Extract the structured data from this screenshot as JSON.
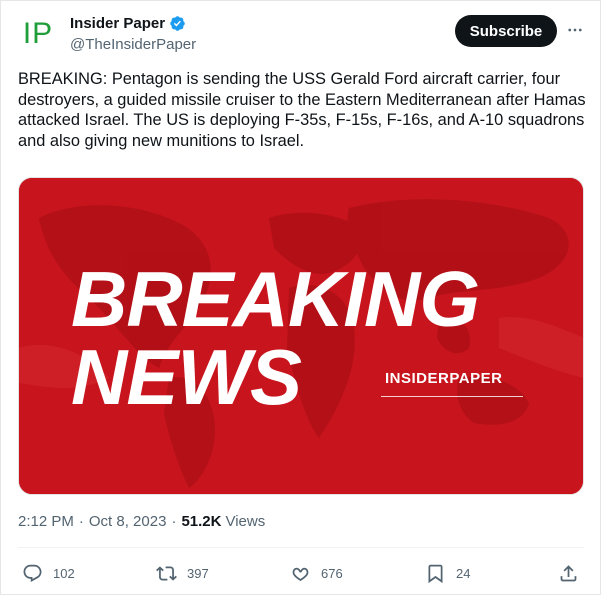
{
  "author": {
    "display_name": "Insider Paper",
    "handle": "@TheInsiderPaper",
    "avatar_text": "IP",
    "verified": true
  },
  "subscribe_label": "Subscribe",
  "tweet": {
    "text": "BREAKING: Pentagon is sending the USS Gerald Ford aircraft carrier, four destroyers, a guided missile cruiser to the Eastern Mediterranean after Hamas attacked Israel. The US is deploying F-35s, F-15s, F-16s, and A-10 squadrons and also giving new munitions to Israel."
  },
  "media": {
    "headline_line1": "BREAKING",
    "headline_line2": "NEWS",
    "brand": "INSIDERPAPER",
    "background_color": "#c8141c"
  },
  "meta": {
    "time": "2:12 PM",
    "separator": "·",
    "date": "Oct 8, 2023",
    "views_count": "51.2K",
    "views_label": "Views"
  },
  "actions": {
    "replies": "102",
    "reposts": "397",
    "likes": "676",
    "bookmarks": "24"
  },
  "colors": {
    "accent_verified": "#1d9bf0",
    "text_primary": "#0f1419",
    "text_secondary": "#536471",
    "avatar_green": "#1f9e3a"
  }
}
